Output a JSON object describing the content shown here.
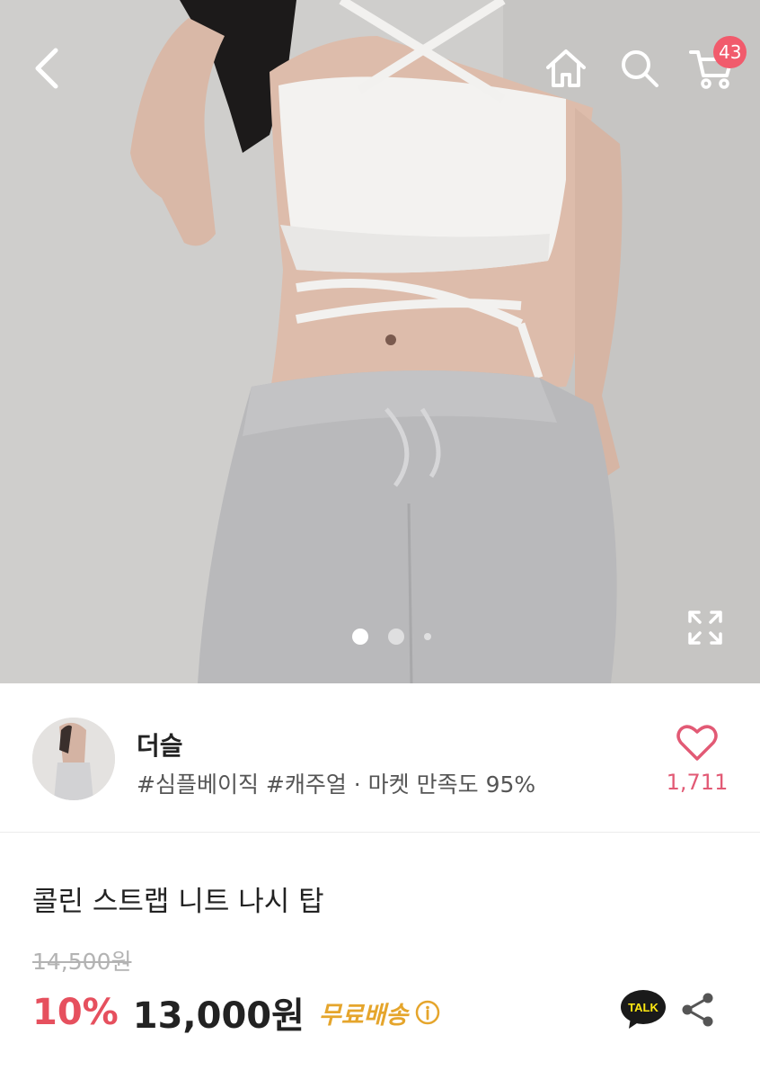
{
  "header": {
    "back_icon": "chevron-left-icon",
    "home_icon": "home-icon",
    "search_icon": "search-icon",
    "cart_icon": "cart-icon",
    "cart_count": "43"
  },
  "gallery": {
    "image_count": 3,
    "current_index": 0,
    "expand_icon": "expand-icon"
  },
  "seller": {
    "name": "더슬",
    "tags": "#심플베이직 #캐주얼 · 마켓 만족도 95%",
    "like_count": "1,711",
    "heart_icon": "heart-icon"
  },
  "product": {
    "title": "콜린 스트랩 니트 나시 탑",
    "original_price": "14,500원",
    "discount": "10%",
    "price": "13,000원",
    "shipping": "무료배송",
    "info_icon": "info-icon",
    "talk_label": "TALK",
    "share_icon": "share-icon"
  },
  "colors": {
    "accent_red": "#e6505e",
    "badge": "#f15b6c",
    "shipping": "#e5a52c",
    "like": "#e25a75"
  }
}
